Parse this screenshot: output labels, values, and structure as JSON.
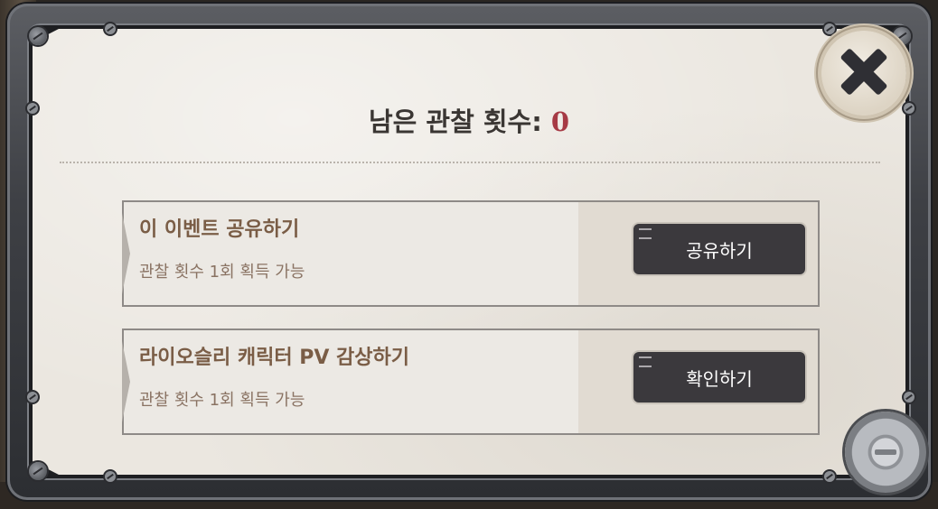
{
  "dialog": {
    "title_label": "남은 관찰 횟수:",
    "remaining_count": "0",
    "close_icon": "close-icon",
    "gear_icon": "gear-icon"
  },
  "events": [
    {
      "title": "이 이벤트 공유하기",
      "description": "관찰 횟수 1회 획득 가능",
      "button_label": "공유하기"
    },
    {
      "title": "라이오슬리 캐릭터 PV 감상하기",
      "description": "관찰 횟수 1회 획득 가능",
      "button_label": "확인하기"
    }
  ],
  "colors": {
    "count_accent": "#a63a45",
    "button_bg": "#3b393d",
    "card_title": "#7a5d46"
  }
}
